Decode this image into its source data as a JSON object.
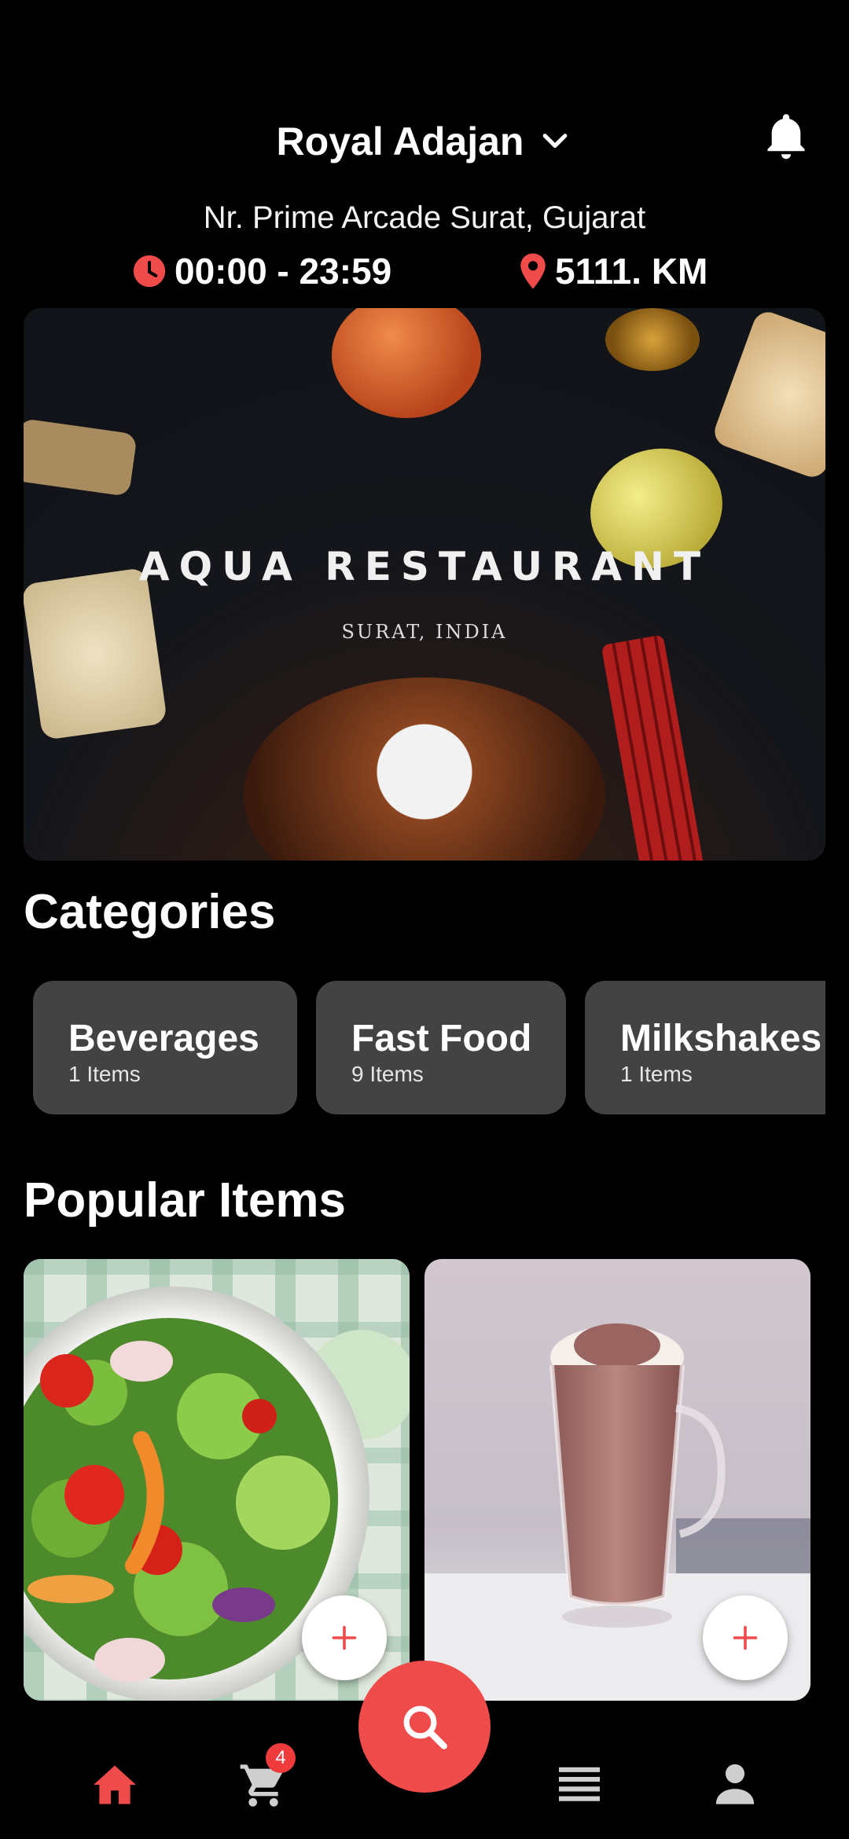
{
  "header": {
    "store_name": "Royal Adajan",
    "address": "Nr. Prime Arcade Surat, Gujarat",
    "hours": "00:00 - 23:59",
    "distance": "5111. KM"
  },
  "banner": {
    "title": "AQUA RESTAURANT",
    "subtitle": "SURAT, INDIA"
  },
  "categories": {
    "title": "Categories",
    "items": [
      {
        "name": "Beverages",
        "count": "1 Items"
      },
      {
        "name": "Fast Food",
        "count": "9 Items"
      },
      {
        "name": "Milkshakes",
        "count": "1 Items"
      }
    ]
  },
  "popular": {
    "title": "Popular Items",
    "items": [
      {
        "image": "salad-photo"
      },
      {
        "image": "hot-chocolate-photo"
      }
    ]
  },
  "nav": {
    "cart_count": "4",
    "items": [
      "home-icon",
      "cart-icon",
      "search-icon",
      "menu-icon",
      "profile-icon"
    ]
  },
  "colors": {
    "accent": "#ef4b4b",
    "background": "#000000",
    "card": "#434343"
  }
}
